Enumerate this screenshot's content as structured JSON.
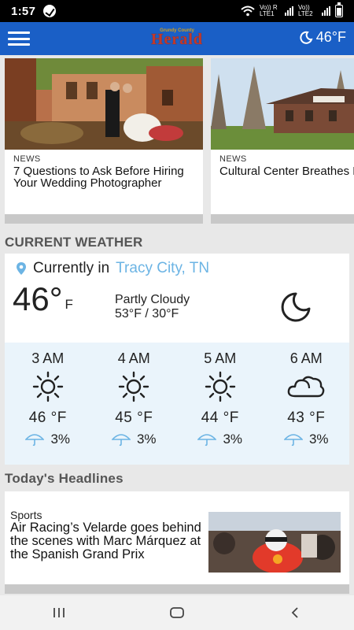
{
  "status_bar": {
    "time": "1:57",
    "carrier1": "Vo)) R LTE1",
    "carrier2": "Vo)) LTE2"
  },
  "header": {
    "logo_small": "Grundy County",
    "logo_big": "Herald",
    "weather_temp": "46°F"
  },
  "articles": [
    {
      "category": "NEWS",
      "title": "7 Questions to Ask Before Hiring Your Wedding Photographer"
    },
    {
      "category": "NEWS",
      "title": "Cultural Center Breathes Life into Historic School"
    }
  ],
  "current_weather": {
    "section_title": "CURRENT WEATHER",
    "location_prefix": "Currently in",
    "city": "Tracy City, TN",
    "temp": "46°",
    "temp_unit": "F",
    "condition": "Partly Cloudy",
    "high_low": "53°F / 30°F",
    "hourly": [
      {
        "time": "3 AM",
        "icon": "sun-icon",
        "temp": "46 °F",
        "precip": "3%"
      },
      {
        "time": "4 AM",
        "icon": "sun-icon",
        "temp": "45 °F",
        "precip": "3%"
      },
      {
        "time": "5 AM",
        "icon": "sun-icon",
        "temp": "44 °F",
        "precip": "3%"
      },
      {
        "time": "6 AM",
        "icon": "cloud-icon",
        "temp": "43 °F",
        "precip": "3%"
      }
    ]
  },
  "headlines": {
    "section_title": "Today's Headlines",
    "items": [
      {
        "category": "Sports",
        "title": "Air Racing’s Velarde goes behind the scenes with Marc Márquez at the Spanish Grand Prix"
      }
    ]
  },
  "colors": {
    "appbar": "#1a5fc6",
    "city_link": "#6cb4e4",
    "hourly_bg": "#eaf4fb"
  }
}
